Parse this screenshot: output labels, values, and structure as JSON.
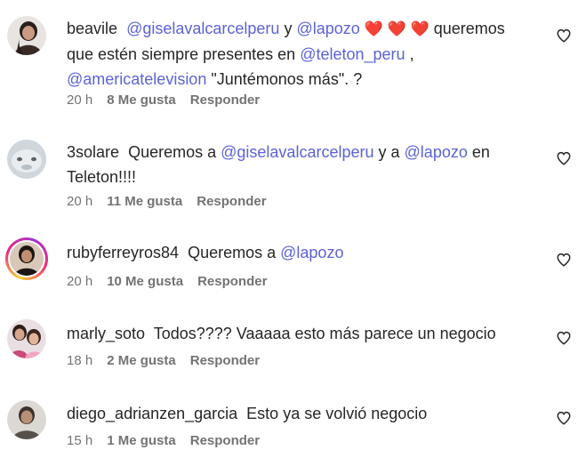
{
  "comments": [
    {
      "username": "beavile",
      "m1": "@giselavalcarcelperu",
      "t1": "y",
      "m2": "@lapozo",
      "hearts": "❤️ ❤️ ❤️",
      "t2": "queremos que estén siempre presentes en",
      "m3": "@teleton_peru",
      "t3": ",",
      "m4": "@americatelevision",
      "t4": "\"Juntémonos más\". ?",
      "time": "20 h",
      "likes": "8 Me gusta",
      "reply": "Responder"
    },
    {
      "username": "3solare",
      "t1": "Queremos a",
      "m1": "@giselavalcarcelperu",
      "t2": "y a",
      "m2": "@lapozo",
      "t3": "en Teleton!!!!",
      "time": "20 h",
      "likes": "11 Me gusta",
      "reply": "Responder"
    },
    {
      "username": "rubyferreyros84",
      "t1": "Queremos a",
      "m1": "@lapozo",
      "time": "20 h",
      "likes": "10 Me gusta",
      "reply": "Responder"
    },
    {
      "username": "marly_soto",
      "t1": "Todos???? Vaaaaa esto más parece un negocio",
      "time": "18 h",
      "likes": "2 Me gusta",
      "reply": "Responder"
    },
    {
      "username": "diego_adrianzen_garcia",
      "t1": "Esto ya se volvió negocio",
      "time": "15 h",
      "likes": "1 Me gusta",
      "reply": "Responder"
    }
  ],
  "colors": {
    "mention": "#5b63d6",
    "text": "#262626",
    "meta": "#737373",
    "heart": "#ef2d56"
  }
}
